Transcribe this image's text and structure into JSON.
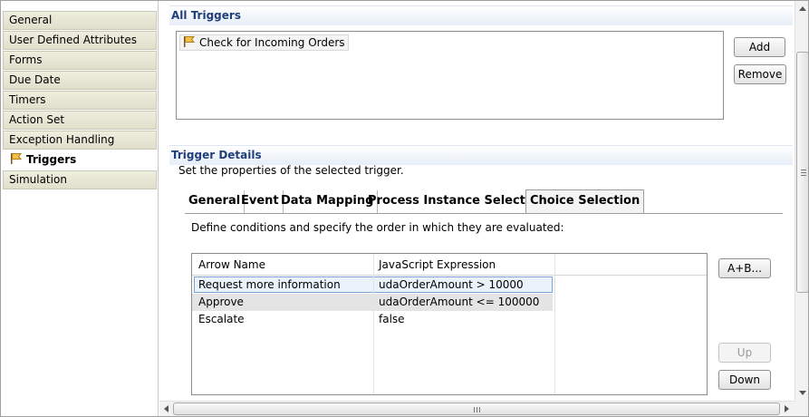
{
  "sidebar": {
    "items": [
      {
        "label": "General"
      },
      {
        "label": "User Defined Attributes"
      },
      {
        "label": "Forms"
      },
      {
        "label": "Due Date"
      },
      {
        "label": "Timers"
      },
      {
        "label": "Action Set"
      },
      {
        "label": "Exception Handling"
      },
      {
        "label": "Triggers",
        "active": true
      },
      {
        "label": "Simulation"
      }
    ]
  },
  "all_triggers": {
    "title": "All Triggers",
    "items": [
      "Check for Incoming Orders"
    ],
    "add_label": "Add",
    "remove_label": "Remove"
  },
  "trigger_details": {
    "title": "Trigger Details",
    "description": "Set the properties of the selected trigger.",
    "tabs": [
      "General",
      "Event",
      "Data Mapping",
      "Process Instance Selection",
      "Choice Selection"
    ],
    "active_tab": "Choice Selection",
    "choice": {
      "description": "Define conditions and specify the order in which they are evaluated:",
      "columns": [
        "Arrow Name",
        "JavaScript Expression"
      ],
      "rows": [
        {
          "arrow": "Request more information",
          "expression": "udaOrderAmount >  10000"
        },
        {
          "arrow": "Approve",
          "expression": "udaOrderAmount <= 100000"
        },
        {
          "arrow": "Escalate",
          "expression": "false"
        }
      ],
      "buttons": {
        "ab_label": "A+B...",
        "up_label": "Up",
        "down_label": "Down"
      }
    }
  },
  "scrollbar": {
    "grip_symbol": "III"
  },
  "colors": {
    "section_title": "#1f3f7a",
    "nav_background": "#e0dfcc",
    "selection": "#eaf2fc"
  }
}
